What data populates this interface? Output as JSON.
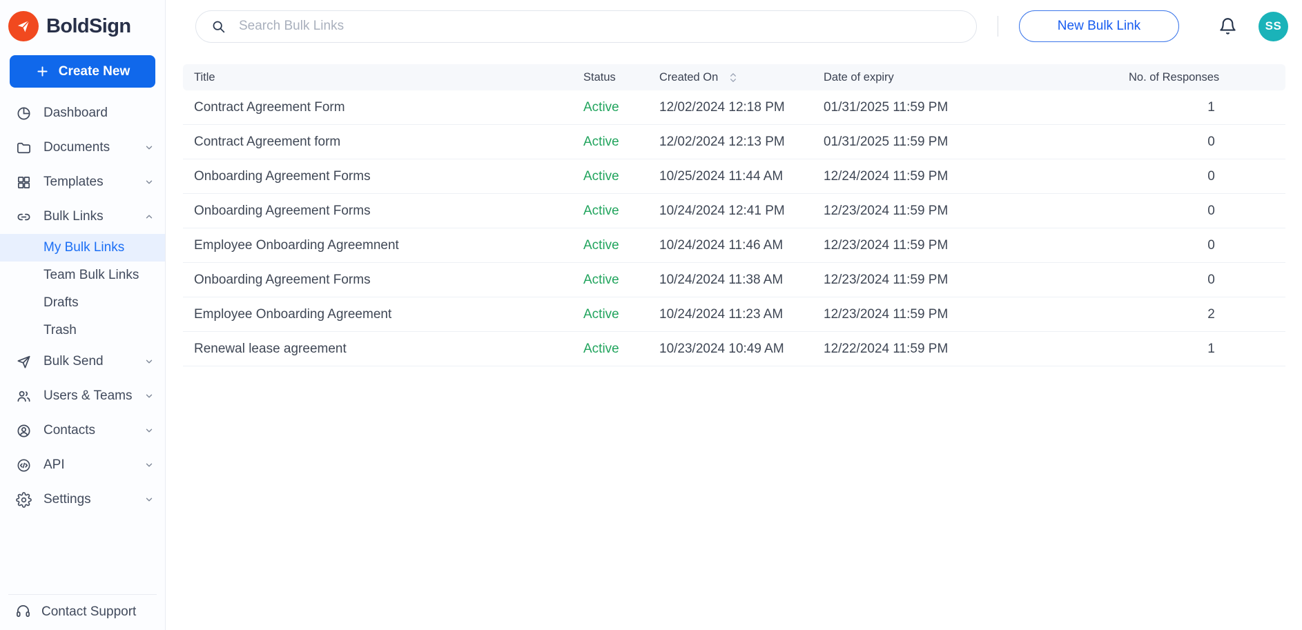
{
  "brand": {
    "name": "BoldSign"
  },
  "colors": {
    "accent_blue": "#1068EB",
    "link_blue": "#1A6EF5",
    "brand_orange": "#F1491F",
    "active_green": "#21A45D",
    "avatar_teal": "#1AB3B9",
    "navy_text": "#283048",
    "table_header_bg": "#F6F8FB"
  },
  "sidebar": {
    "create_new_label": "Create New",
    "items": [
      {
        "label": "Dashboard",
        "icon": "dashboard-pie-icon"
      },
      {
        "label": "Documents",
        "icon": "folder-icon",
        "expandable": true
      },
      {
        "label": "Templates",
        "icon": "grid-icon",
        "expandable": true
      },
      {
        "label": "Bulk Links",
        "icon": "link-icon",
        "expandable": true,
        "expanded": true
      },
      {
        "label": "Bulk Send",
        "icon": "paper-plane-icon",
        "expandable": true
      },
      {
        "label": "Users & Teams",
        "icon": "users-icon",
        "expandable": true
      },
      {
        "label": "Contacts",
        "icon": "contact-icon",
        "expandable": true
      },
      {
        "label": "API",
        "icon": "code-circle-icon",
        "expandable": true
      },
      {
        "label": "Settings",
        "icon": "gear-icon",
        "expandable": true
      }
    ],
    "bulk_links_children": [
      {
        "label": "My Bulk Links",
        "active": true
      },
      {
        "label": "Team Bulk Links"
      },
      {
        "label": "Drafts"
      },
      {
        "label": "Trash"
      }
    ],
    "contact_support_label": "Contact Support"
  },
  "topbar": {
    "search_placeholder": "Search Bulk Links",
    "new_bulk_link_label": "New Bulk Link",
    "avatar_initials": "SS"
  },
  "table": {
    "columns": [
      "Title",
      "Status",
      "Created On",
      "Date of expiry",
      "No. of Responses"
    ],
    "sorted_column": "Created On",
    "rows": [
      {
        "title": "Contract Agreement Form",
        "status": "Active",
        "created_on": "12/02/2024 12:18 PM",
        "date_of_expiry": "01/31/2025 11:59 PM",
        "responses": "1"
      },
      {
        "title": "Contract Agreement form",
        "status": "Active",
        "created_on": "12/02/2024 12:13 PM",
        "date_of_expiry": "01/31/2025 11:59 PM",
        "responses": "0"
      },
      {
        "title": "Onboarding Agreement Forms",
        "status": "Active",
        "created_on": "10/25/2024 11:44 AM",
        "date_of_expiry": "12/24/2024 11:59 PM",
        "responses": "0"
      },
      {
        "title": "Onboarding Agreement Forms",
        "status": "Active",
        "created_on": "10/24/2024 12:41 PM",
        "date_of_expiry": "12/23/2024 11:59 PM",
        "responses": "0"
      },
      {
        "title": "Employee Onboarding Agreemnent",
        "status": "Active",
        "created_on": "10/24/2024 11:46 AM",
        "date_of_expiry": "12/23/2024 11:59 PM",
        "responses": "0"
      },
      {
        "title": "Onboarding Agreement Forms",
        "status": "Active",
        "created_on": "10/24/2024 11:38 AM",
        "date_of_expiry": "12/23/2024 11:59 PM",
        "responses": "0"
      },
      {
        "title": "Employee Onboarding Agreement",
        "status": "Active",
        "created_on": "10/24/2024 11:23 AM",
        "date_of_expiry": "12/23/2024 11:59 PM",
        "responses": "2"
      },
      {
        "title": "Renewal lease agreement",
        "status": "Active",
        "created_on": "10/23/2024 10:49 AM",
        "date_of_expiry": "12/22/2024 11:59 PM",
        "responses": "1"
      }
    ]
  }
}
